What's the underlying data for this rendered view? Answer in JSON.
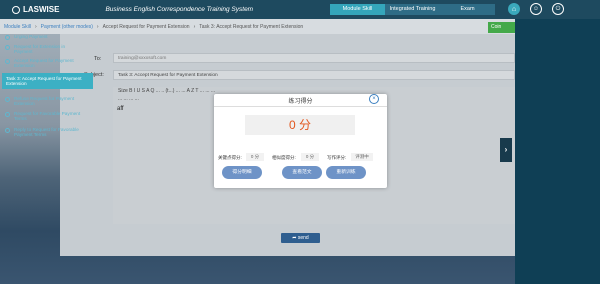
{
  "header": {
    "logo": "LASWISE",
    "system_title": "Business English Correspondence Training System",
    "nav_tabs": [
      {
        "label": "Module Skill",
        "active": true
      },
      {
        "label": "Integrated Training",
        "active": false
      },
      {
        "label": "Exam",
        "active": false
      }
    ],
    "icons": [
      "home-icon",
      "user-icon",
      "power-icon"
    ]
  },
  "breadcrumb": [
    "Module Skill",
    "Payment (other modes)",
    "Accept Request for Payment Extension",
    "Task 3: Accept Request for Payment Extension"
  ],
  "card_button": "Coin",
  "form": {
    "to_label": "To:",
    "to_value": "training@xxxxsoft.com",
    "subject_label": "Subject:",
    "subject_value": "Task 3: Accept Request for Payment Extension",
    "toolbar_row1": "Size   B  I  U  S  A  Q  ...  ..  (t...)  ...  ...  A  Z  T  ...  ...  ...",
    "toolbar_row2": "...  ...  ...  ...",
    "body_text": "aff",
    "send_label": "send"
  },
  "sidebar": {
    "items": [
      {
        "label": "Urging Payment",
        "active": false
      },
      {
        "label": "Request for Extension in Payment",
        "active": false
      },
      {
        "label": "Accept Request for Payment Extension",
        "active": false
      },
      {
        "label": "Task 3: Accept Request for Payment Extension",
        "active": true
      },
      {
        "label": "Refuse Request for Payment Extension",
        "active": false
      },
      {
        "label": "Request for Favorable Payment Terms",
        "active": false
      },
      {
        "label": "Reply to Request for Favorable Payment Terms",
        "active": false
      }
    ]
  },
  "modal": {
    "title": "练习得分",
    "score": "0 分",
    "stats": [
      {
        "label": "关键点得分:",
        "value": "0 分"
      },
      {
        "label": "相似度得分:",
        "value": "0 分"
      },
      {
        "label": "写作评分:",
        "value": "评测中"
      }
    ],
    "buttons": [
      "得分明细",
      "查看范文",
      "重新训练"
    ]
  },
  "colors": {
    "header_bg": "#1e4a5f",
    "active_tab": "#34a6bb",
    "sidebar_bg": "#0f3f55",
    "sidebar_active": "#3cb0c4",
    "score_orange": "#e2571e",
    "modal_button": "#6e93c7",
    "send_button": "#2f5e8f"
  }
}
